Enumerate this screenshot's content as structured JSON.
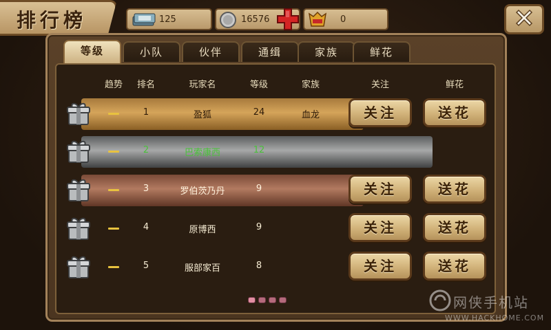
{
  "header": {
    "title": "排行榜",
    "resources": [
      {
        "icon": "money-stack-icon",
        "value": "125"
      },
      {
        "icon": "silver-coin-icon",
        "value": "16576"
      },
      {
        "icon": "badge-icon",
        "value": "0"
      }
    ],
    "add_icon": "red-plus-icon",
    "close_icon": "close-icon"
  },
  "tabs": [
    "等级",
    "小队",
    "伙伴",
    "通缉",
    "家族",
    "鲜花"
  ],
  "active_tab": "等级",
  "columns": [
    "趋势",
    "排名",
    "玩家名",
    "等级",
    "家族",
    "关注",
    "鲜花"
  ],
  "rows": [
    {
      "rank": "1",
      "name": "盈狐",
      "level": "24",
      "family": "血龙",
      "follow": "关注",
      "flower": "送花"
    },
    {
      "rank": "2",
      "name": "巴索康西",
      "level": "12",
      "family": "",
      "follow": "",
      "flower": ""
    },
    {
      "rank": "3",
      "name": "罗伯茨乃丹",
      "level": "9",
      "family": "",
      "follow": "关注",
      "flower": "送花"
    },
    {
      "rank": "4",
      "name": "原博西",
      "level": "9",
      "family": "",
      "follow": "关注",
      "flower": "送花"
    },
    {
      "rank": "5",
      "name": "服部家百",
      "level": "8",
      "family": "",
      "follow": "关注",
      "flower": "送花"
    }
  ],
  "pager": {
    "pages": 4,
    "current": 1
  },
  "watermark": {
    "cn": "网侠手机站",
    "en": "WWW.HACKHOME.COM"
  },
  "colors": {
    "accent": "#d5a45a",
    "self_row": "#4ac13a",
    "flower_plus": "#d42424"
  }
}
